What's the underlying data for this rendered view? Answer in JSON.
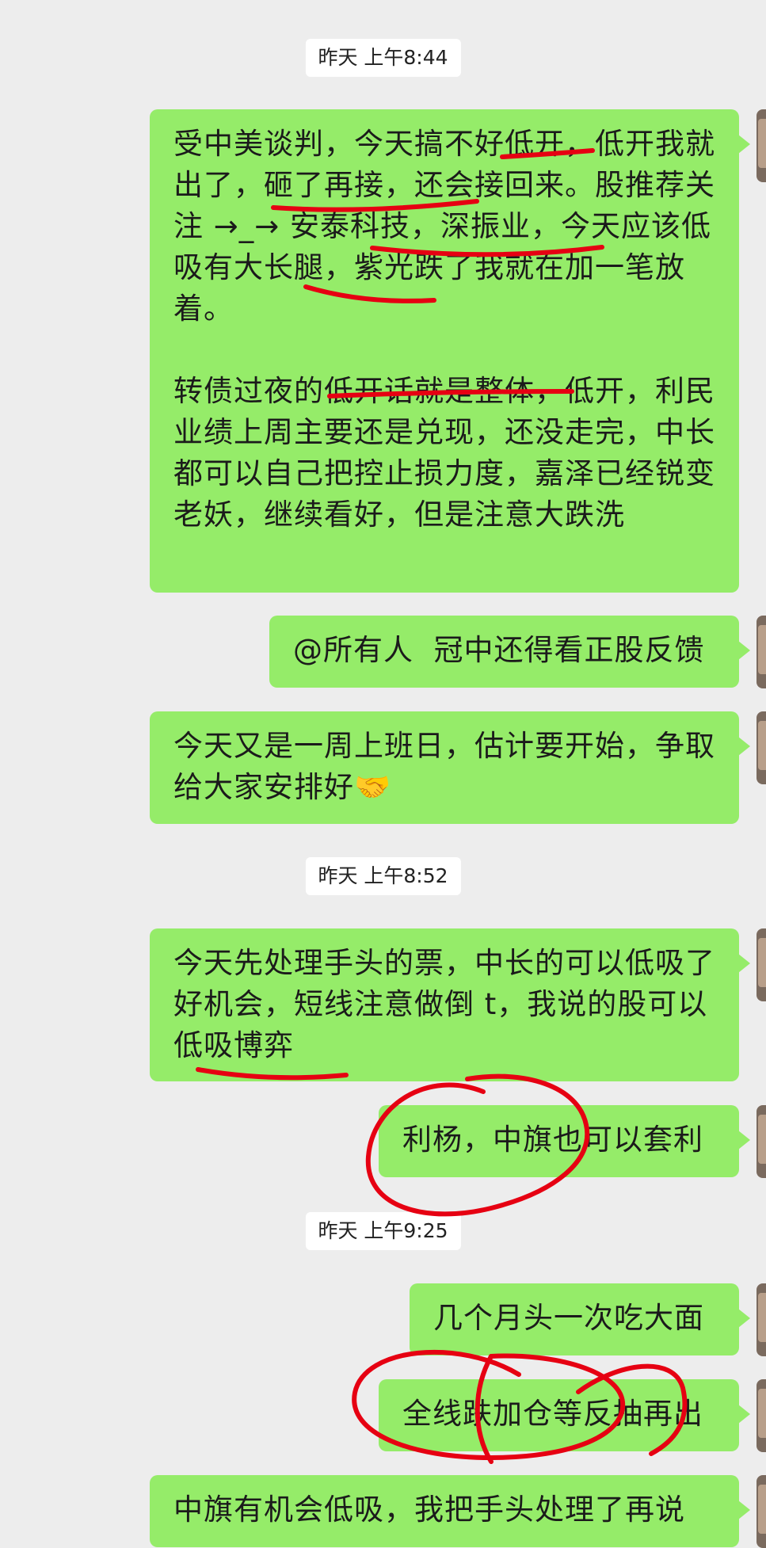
{
  "chat": {
    "timestamps": [
      {
        "text": "昨天 上午8:44"
      },
      {
        "text": "昨天 上午8:52"
      },
      {
        "text": "昨天 上午9:25"
      }
    ],
    "messages": [
      {
        "text": "受中美谈判，今天搞不好低开，低开我就出了，砸了再接，还会接回来。股推荐关注 →_→ 安泰科技，深振业，今天应该低吸有大长腿，紫光跌了我就在加一笔放着。\n\n转债过夜的低开话就是整体，低开，利民业绩上周主要还是兑现，还没走完，中长都可以自己把控止损力度，嘉泽已经锐变老妖，继续看好，但是注意大跌洗"
      },
      {
        "text": "@所有人  冠中还得看正股反馈"
      },
      {
        "text": "今天又是一周上班日，估计要开始，争取给大家安排好🤝"
      },
      {
        "text": "今天先处理手头的票，中长的可以低吸了好机会，短线注意做倒 t，我说的股可以低吸博弈"
      },
      {
        "text": "利杨，中旗也可以套利"
      },
      {
        "text": "几个月头一次吃大面"
      },
      {
        "text": "全线跌加仓等反抽再出"
      },
      {
        "text": "中旗有机会低吸，我把手头处理了再说"
      }
    ]
  },
  "colors": {
    "background": "#ededed",
    "bubble": "#95ec69",
    "annotation": "#e60012"
  }
}
